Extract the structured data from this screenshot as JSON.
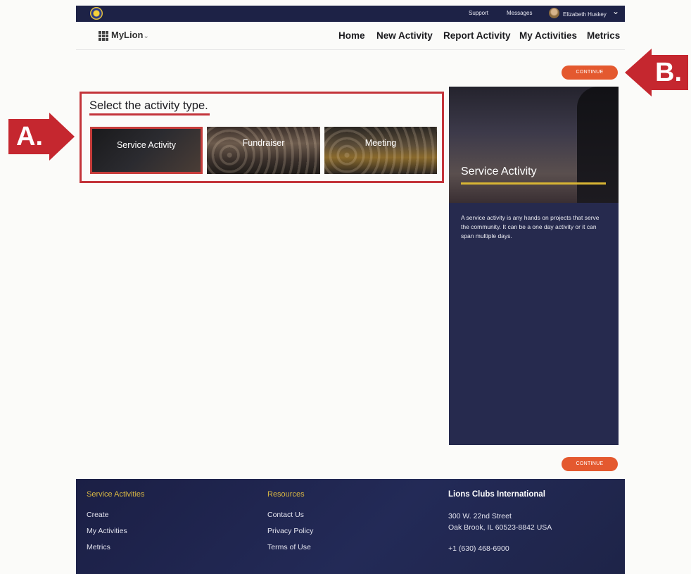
{
  "topbar": {
    "links": [
      "Support",
      "Messages"
    ],
    "user_name": "Elizabeth Huskey"
  },
  "nav": {
    "brand": "MyLion",
    "items": [
      "Home",
      "New Activity",
      "Report Activity",
      "My Activities",
      "Metrics"
    ]
  },
  "buttons": {
    "continue_label": "CONTINUE"
  },
  "callouts": {
    "a": "A.",
    "b": "B."
  },
  "activity": {
    "heading": "Select the activity type.",
    "types": [
      "Service Activity",
      "Fundraiser",
      "Meeting"
    ],
    "selected": "Service Activity"
  },
  "panel": {
    "title": "Service Activity",
    "description": "A service activity is any hands on projects that serve the community. It can be a one day activity or it can span multiple days."
  },
  "footer": {
    "col1": {
      "heading": "Service Activities",
      "links": [
        "Create",
        "My Activities",
        "Metrics"
      ]
    },
    "col2": {
      "heading": "Resources",
      "links": [
        "Contact Us",
        "Privacy Policy",
        "Terms of Use"
      ]
    },
    "col3": {
      "heading": "Lions Clubs International",
      "address1": "300 W. 22nd Street",
      "address2": "Oak Brook, IL 60523-8842 USA",
      "phone": "+1 (630) 468-6900"
    }
  },
  "colors": {
    "topbar": "#1d2246",
    "accent_orange": "#e4592f",
    "callout_red": "#c5272f",
    "panel_navy": "#262a4e",
    "gold": "#d8b534"
  }
}
